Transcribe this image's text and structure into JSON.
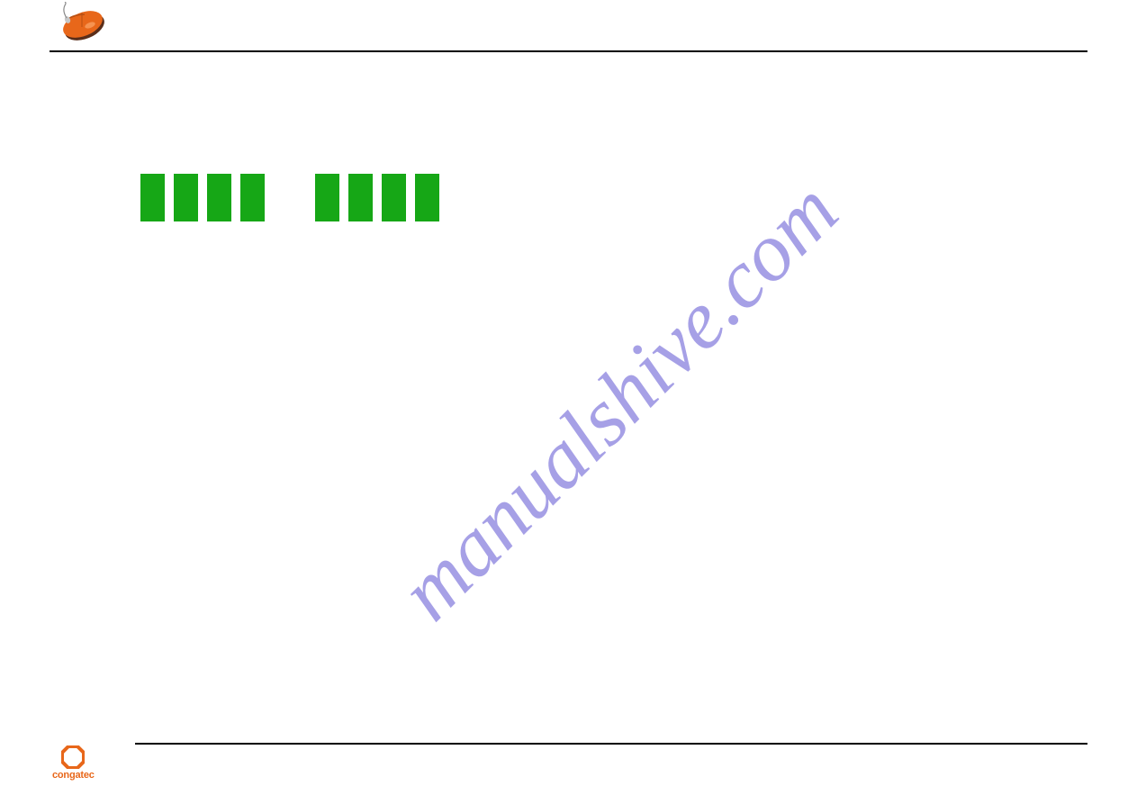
{
  "watermark": "manualshive.com",
  "footer_brand": "congatec",
  "icons": {
    "mouse": "mouse-icon",
    "congatec_octagon": "congatec-octagon-icon"
  },
  "green_block_count": 8
}
